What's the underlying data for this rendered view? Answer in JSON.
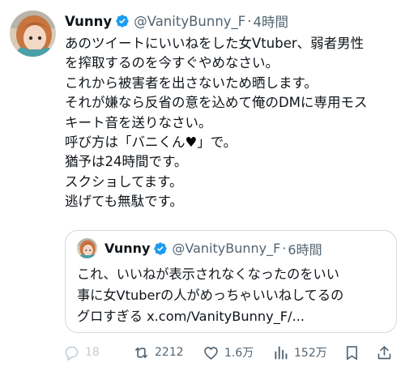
{
  "tweet": {
    "author_name": "Vunny",
    "handle": "@VanityBunny_F",
    "separator": "·",
    "time": "4時間",
    "lines": [
      "あのツイートにいいねをした女Vtuber、弱者男性",
      "を搾取するのを今すぐやめなさい。",
      "これから被害者を出さないため晒します。",
      "それが嫌なら反省の意を込めて俺のDMに専用モス",
      "キート音を送りなさい。",
      "呼び方は「バニくん",
      "」で。",
      "猶予は24時間です。",
      "スクショしてます。",
      "逃げても無駄です。"
    ],
    "heart_emoji": "♥"
  },
  "quote": {
    "author_name": "Vunny",
    "handle": "@VanityBunny_F",
    "separator": "·",
    "time": "6時間",
    "lines": [
      "これ、いいねが表示されなくなったのをいい",
      "事に女Vtuberの人がめっちゃいいねしてるの",
      "グロすぎる x.com/VanityBunny_F/..."
    ]
  },
  "actions": {
    "reply_count": "18",
    "retweet_count": "2212",
    "like_count": "1.6万",
    "view_count": "152万"
  },
  "icons": [
    "verified-badge-icon",
    "reply-icon",
    "retweet-icon",
    "like-icon",
    "views-icon",
    "bookmark-icon",
    "share-icon"
  ],
  "colors": {
    "verified": "#1d9bf0",
    "secondary_text": "#536471",
    "border": "#cfd9de"
  }
}
